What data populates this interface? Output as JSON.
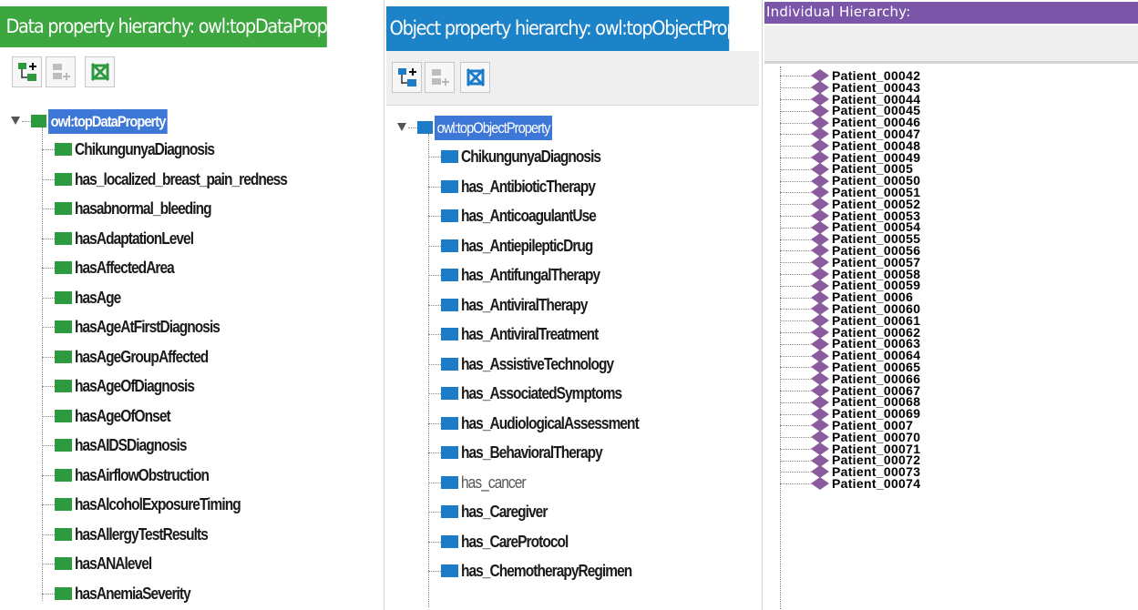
{
  "colors": {
    "data_header": "#3ba73e",
    "object_header": "#1d83c9",
    "individual_header": "#7a55a8",
    "data_property_square": "#2e9a3f",
    "object_property_square": "#1c7cc8",
    "individual_diamond": "#8a5c9e",
    "selection": "#3d78d8"
  },
  "data_panel": {
    "title": "Data property hierarchy: owl:topDataProperty",
    "toolbar": {
      "add_sub_icon": "add-subproperty-icon",
      "add_sibling_icon": "add-sibling-icon",
      "delete_icon": "delete-property-icon"
    },
    "root": "owl:topDataProperty",
    "items": [
      "ChikungunyaDiagnosis",
      "has_localized_breast_pain_redness",
      "hasabnormal_bleeding",
      "hasAdaptationLevel",
      "hasAffectedArea",
      "hasAge",
      "hasAgeAtFirstDiagnosis",
      "hasAgeGroupAffected",
      "hasAgeOfDiagnosis",
      "hasAgeOfOnset",
      "hasAIDSDiagnosis",
      "hasAirflowObstruction",
      "hasAlcoholExposureTiming",
      "hasAllergyTestResults",
      "hasANAlevel",
      "hasAnemiaSeverity"
    ]
  },
  "object_panel": {
    "title": "Object property hierarchy: owl:topObjectProperty",
    "toolbar": {
      "add_sub_icon": "add-subproperty-icon",
      "add_sibling_icon": "add-sibling-icon",
      "delete_icon": "delete-property-icon"
    },
    "root": "owl:topObjectProperty",
    "items": [
      "ChikungunyaDiagnosis",
      "has_AntibioticTherapy",
      "has_AnticoagulantUse",
      "has_AntiepilepticDrug",
      "has_AntifungalTherapy",
      "has_AntiviralTherapy",
      "has_AntiviralTreatment",
      "has_AssistiveTechnology",
      "has_AssociatedSymptoms",
      "has_AudiologicalAssessment",
      "has_BehavioralTherapy",
      "has_cancer",
      "has_Caregiver",
      "has_CareProtocol",
      "has_ChemotherapyRegimen"
    ],
    "light_items": [
      "has_cancer"
    ]
  },
  "individual_panel": {
    "title": "Individual Hierarchy:",
    "items": [
      "Patient_00042",
      "Patient_00043",
      "Patient_00044",
      "Patient_00045",
      "Patient_00046",
      "Patient_00047",
      "Patient_00048",
      "Patient_00049",
      "Patient_0005",
      "Patient_00050",
      "Patient_00051",
      "Patient_00052",
      "Patient_00053",
      "Patient_00054",
      "Patient_00055",
      "Patient_00056",
      "Patient_00057",
      "Patient_00058",
      "Patient_00059",
      "Patient_0006",
      "Patient_00060",
      "Patient_00061",
      "Patient_00062",
      "Patient_00063",
      "Patient_00064",
      "Patient_00065",
      "Patient_00066",
      "Patient_00067",
      "Patient_00068",
      "Patient_00069",
      "Patient_0007",
      "Patient_00070",
      "Patient_00071",
      "Patient_00072",
      "Patient_00073",
      "Patient_00074"
    ]
  }
}
